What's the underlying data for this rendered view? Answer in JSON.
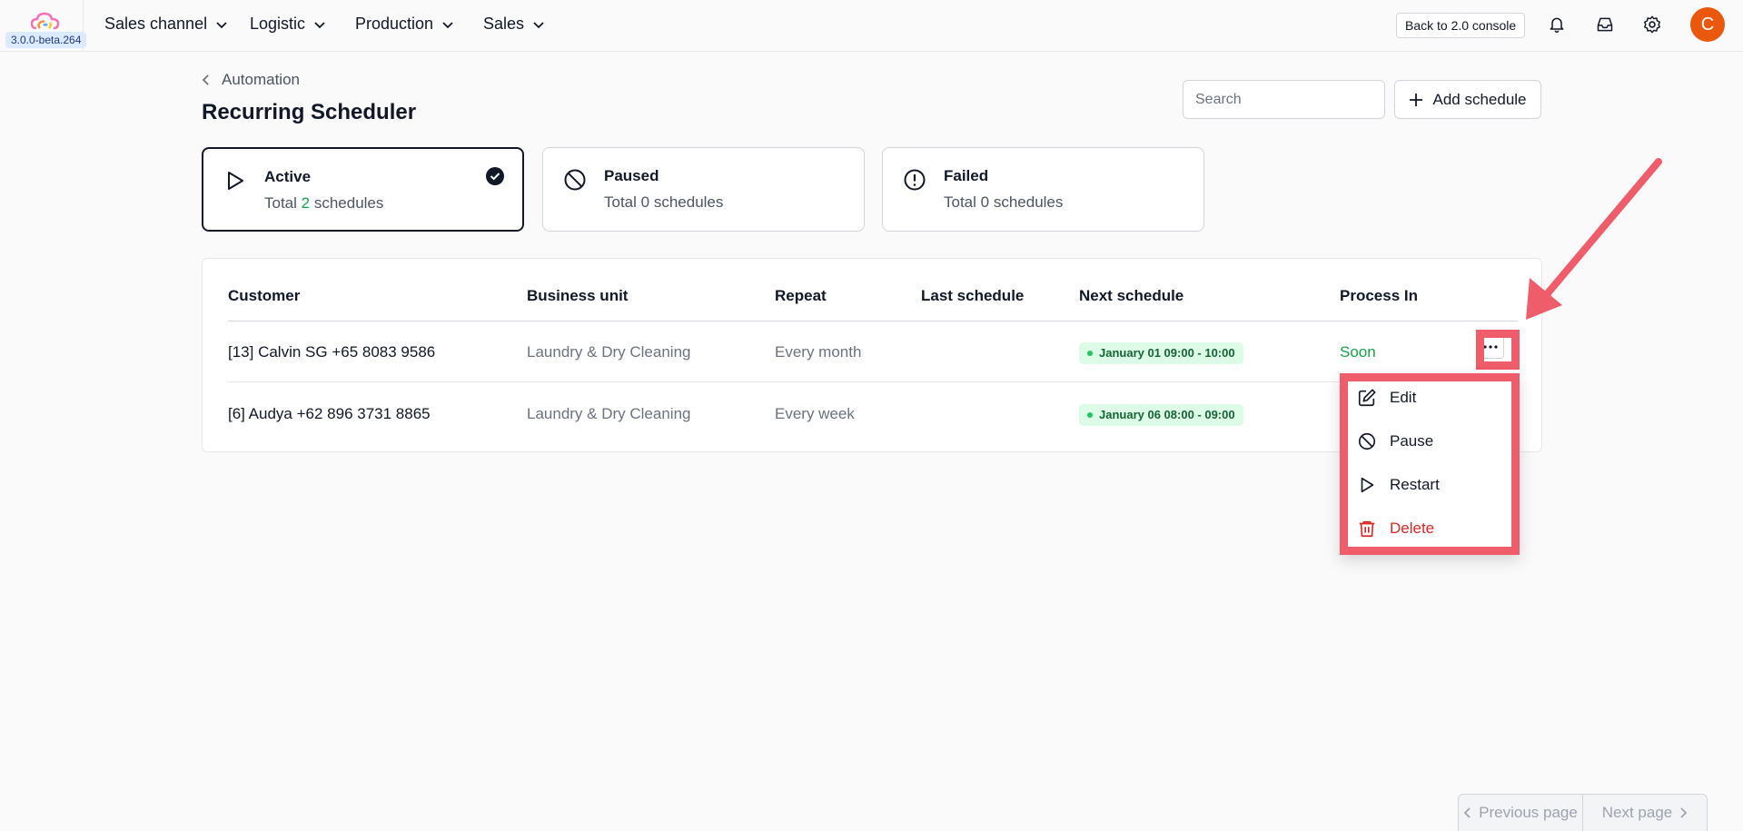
{
  "app": {
    "version": "3.0.0-beta.264",
    "nav": [
      {
        "label": "Sales channel"
      },
      {
        "label": "Logistic"
      },
      {
        "label": "Production"
      },
      {
        "label": "Sales"
      }
    ],
    "back_button": "Back to 2.0 console",
    "avatar_initial": "C"
  },
  "header": {
    "breadcrumb": "Automation",
    "title": "Recurring Scheduler",
    "search_placeholder": "Search",
    "add_button": "Add schedule"
  },
  "status_cards": [
    {
      "title": "Active",
      "prefix": "Total ",
      "count": "2",
      "suffix": " schedules",
      "icon": "play-icon",
      "selected": true
    },
    {
      "title": "Paused",
      "prefix": "Total ",
      "count": "0",
      "suffix": " schedules",
      "icon": "ban-icon",
      "selected": false
    },
    {
      "title": "Failed",
      "prefix": "Total ",
      "count": "0",
      "suffix": " schedules",
      "icon": "alert-circle-icon",
      "selected": false
    }
  ],
  "table": {
    "columns": [
      "Customer",
      "Business unit",
      "Repeat",
      "Last schedule",
      "Next schedule",
      "Process In"
    ],
    "rows": [
      {
        "customer": "[13] Calvin SG +65 8083 9586",
        "business_unit": "Laundry & Dry Cleaning",
        "repeat": "Every month",
        "last_schedule": "",
        "next_schedule": "January 01 09:00 - 10:00",
        "process_in": "Soon"
      },
      {
        "customer": "[6] Audya +62 896 3731 8865",
        "business_unit": "Laundry & Dry Cleaning",
        "repeat": "Every week",
        "last_schedule": "",
        "next_schedule": "January 06 08:00 - 09:00",
        "process_in": ""
      }
    ]
  },
  "row_menu": {
    "items": [
      {
        "label": "Edit",
        "icon": "edit-icon"
      },
      {
        "label": "Pause",
        "icon": "ban-icon"
      },
      {
        "label": "Restart",
        "icon": "play-icon"
      },
      {
        "label": "Delete",
        "icon": "trash-icon"
      }
    ]
  },
  "pagination": {
    "previous": "Previous page",
    "next": "Next page"
  },
  "colors": {
    "accent_green": "#16a34a",
    "highlight": "#ef5c6a",
    "danger": "#dc2626",
    "avatar": "#ea580c"
  }
}
